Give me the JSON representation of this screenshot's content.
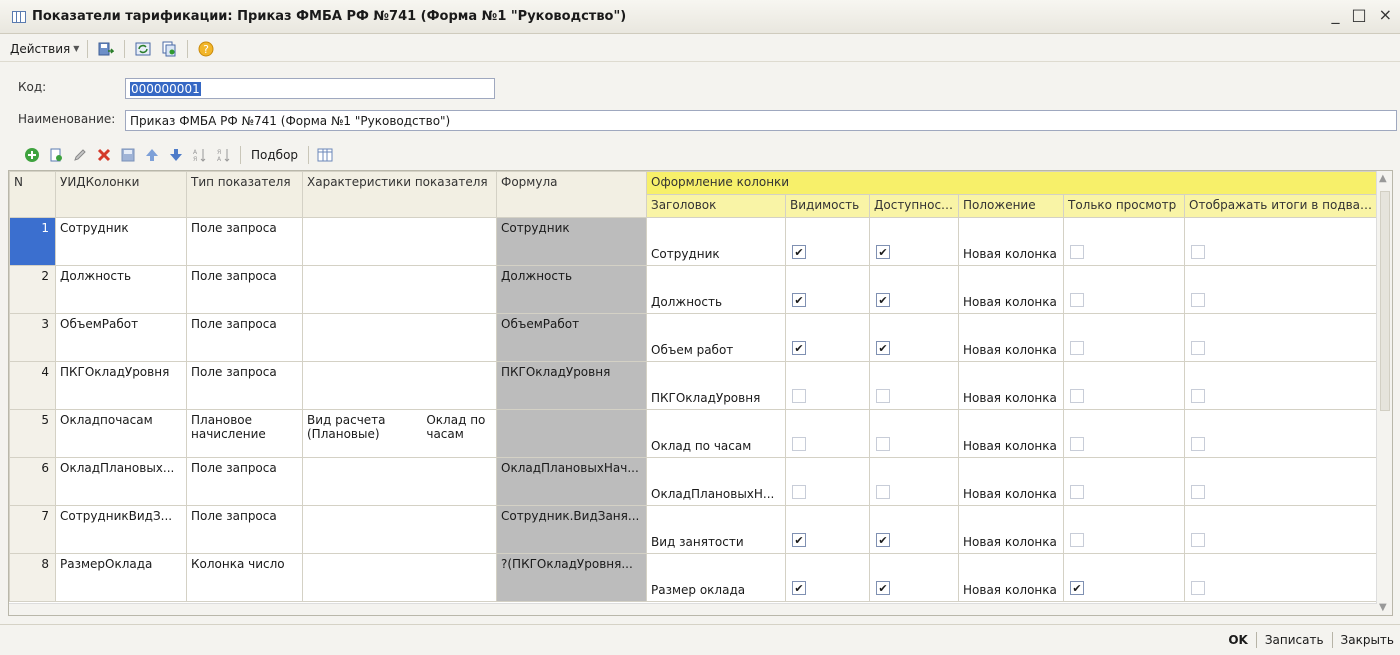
{
  "window": {
    "title": "Показатели тарификации: Приказ ФМБА РФ №741 (Форма №1 \"Руководство\")",
    "minimize": "_",
    "maximize": "□",
    "close": "×"
  },
  "toolbar": {
    "actions_label": "Действия"
  },
  "form": {
    "code_label": "Код:",
    "code_value": "000000001",
    "name_label": "Наименование:",
    "name_value": "Приказ ФМБА РФ №741 (Форма №1 \"Руководство\")"
  },
  "grid_toolbar": {
    "select_label": "Подбор"
  },
  "table": {
    "headers": {
      "n": "N",
      "uid": "УИДКолонки",
      "type": "Тип показателя",
      "chars": "Характеристики показателя",
      "formula": "Формула",
      "group": "Оформление колонки",
      "caption": "Заголовок",
      "visible": "Видимость",
      "available": "Доступность",
      "position": "Положение",
      "readonly": "Только просмотр",
      "footer_totals": "Отображать итоги в подвале"
    },
    "rows": [
      {
        "n": "1",
        "uid": "Сотрудник",
        "type": "Поле запроса",
        "char1": "",
        "char2": "",
        "formula": "Сотрудник",
        "caption": "Сотрудник",
        "visible": true,
        "available": true,
        "position": "Новая колонка",
        "readonly": false,
        "totals": false
      },
      {
        "n": "2",
        "uid": "Должность",
        "type": "Поле запроса",
        "char1": "",
        "char2": "",
        "formula": "Должность",
        "caption": "Должность",
        "visible": true,
        "available": true,
        "position": "Новая колонка",
        "readonly": false,
        "totals": false
      },
      {
        "n": "3",
        "uid": "ОбъемРабот",
        "type": "Поле запроса",
        "char1": "",
        "char2": "",
        "formula": "ОбъемРабот",
        "caption": "Объем работ",
        "visible": true,
        "available": true,
        "position": "Новая колонка",
        "readonly": false,
        "totals": false
      },
      {
        "n": "4",
        "uid": "ПКГОкладУровня",
        "type": "Поле запроса",
        "char1": "",
        "char2": "",
        "formula": "ПКГОкладУровня",
        "caption": "ПКГОкладУровня",
        "visible": false,
        "available": false,
        "position": "Новая колонка",
        "readonly": false,
        "totals": false
      },
      {
        "n": "5",
        "uid": "Окладпочасам",
        "type": "Плановое начисление",
        "char1": "Вид расчета (Плановые)",
        "char2": "Оклад по часам",
        "formula": "",
        "caption": "Оклад по часам",
        "visible": false,
        "available": false,
        "position": "Новая колонка",
        "readonly": false,
        "totals": false
      },
      {
        "n": "6",
        "uid": "ОкладПлановых...",
        "type": "Поле запроса",
        "char1": "",
        "char2": "",
        "formula": "ОкладПлановыхНач...",
        "caption": "ОкладПлановыхН...",
        "visible": false,
        "available": false,
        "position": "Новая колонка",
        "readonly": false,
        "totals": false
      },
      {
        "n": "7",
        "uid": "СотрудникВидЗ...",
        "type": "Поле запроса",
        "char1": "",
        "char2": "",
        "formula": "Сотрудник.ВидЗаня...",
        "caption": "Вид занятости",
        "visible": true,
        "available": true,
        "position": "Новая колонка",
        "readonly": false,
        "totals": false
      },
      {
        "n": "8",
        "uid": "РазмерОклада",
        "type": "Колонка число",
        "char1": "",
        "char2": "",
        "formula": "?(ПКГОкладУровня...",
        "caption": "Размер оклада",
        "visible": true,
        "available": true,
        "position": "Новая колонка",
        "readonly": true,
        "totals": false
      }
    ]
  },
  "footer": {
    "ok": "OK",
    "save": "Записать",
    "close": "Закрыть"
  }
}
